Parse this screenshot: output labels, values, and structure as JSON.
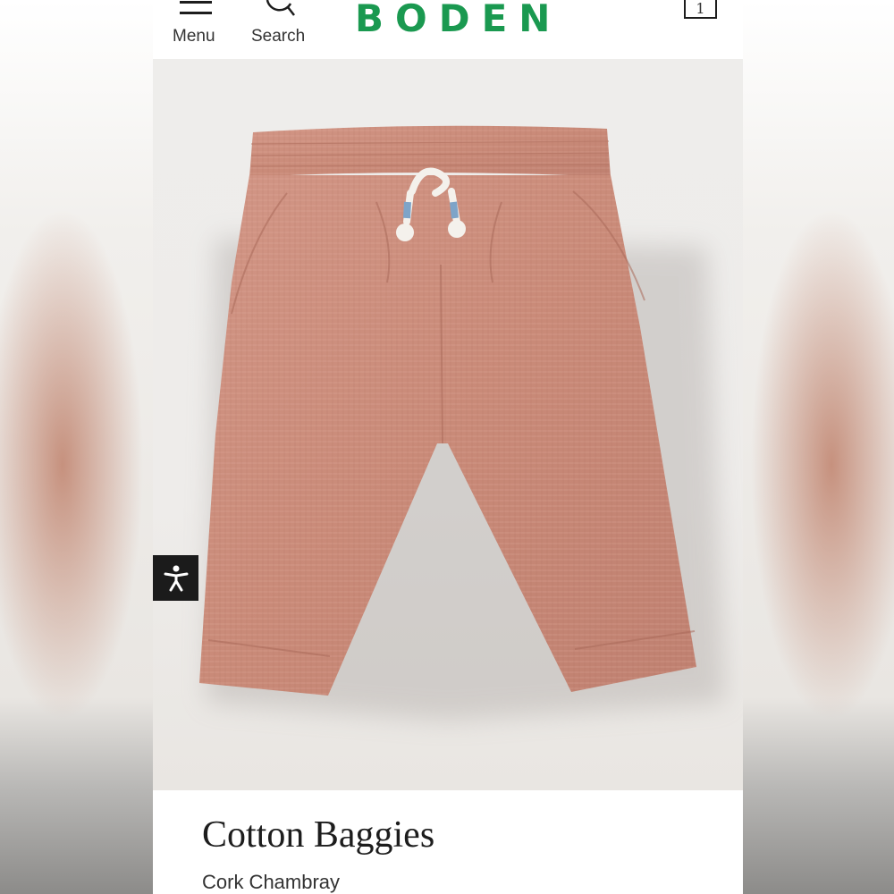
{
  "header": {
    "menu_label": "Menu",
    "search_label": "Search",
    "logo_text": "BODEN",
    "bag_count": "1"
  },
  "product": {
    "title": "Cotton Baggies",
    "color_name": "Cork Chambray",
    "image_subject": "salmon-pink chambray pull-on shorts with white drawstring"
  },
  "colors": {
    "brand_green": "#1a9950",
    "fabric": "#c98b7a",
    "accessibility_bg": "#1b1b1b"
  },
  "icons": [
    "hamburger-menu-icon",
    "search-icon",
    "shopping-bag-icon",
    "accessibility-icon"
  ]
}
